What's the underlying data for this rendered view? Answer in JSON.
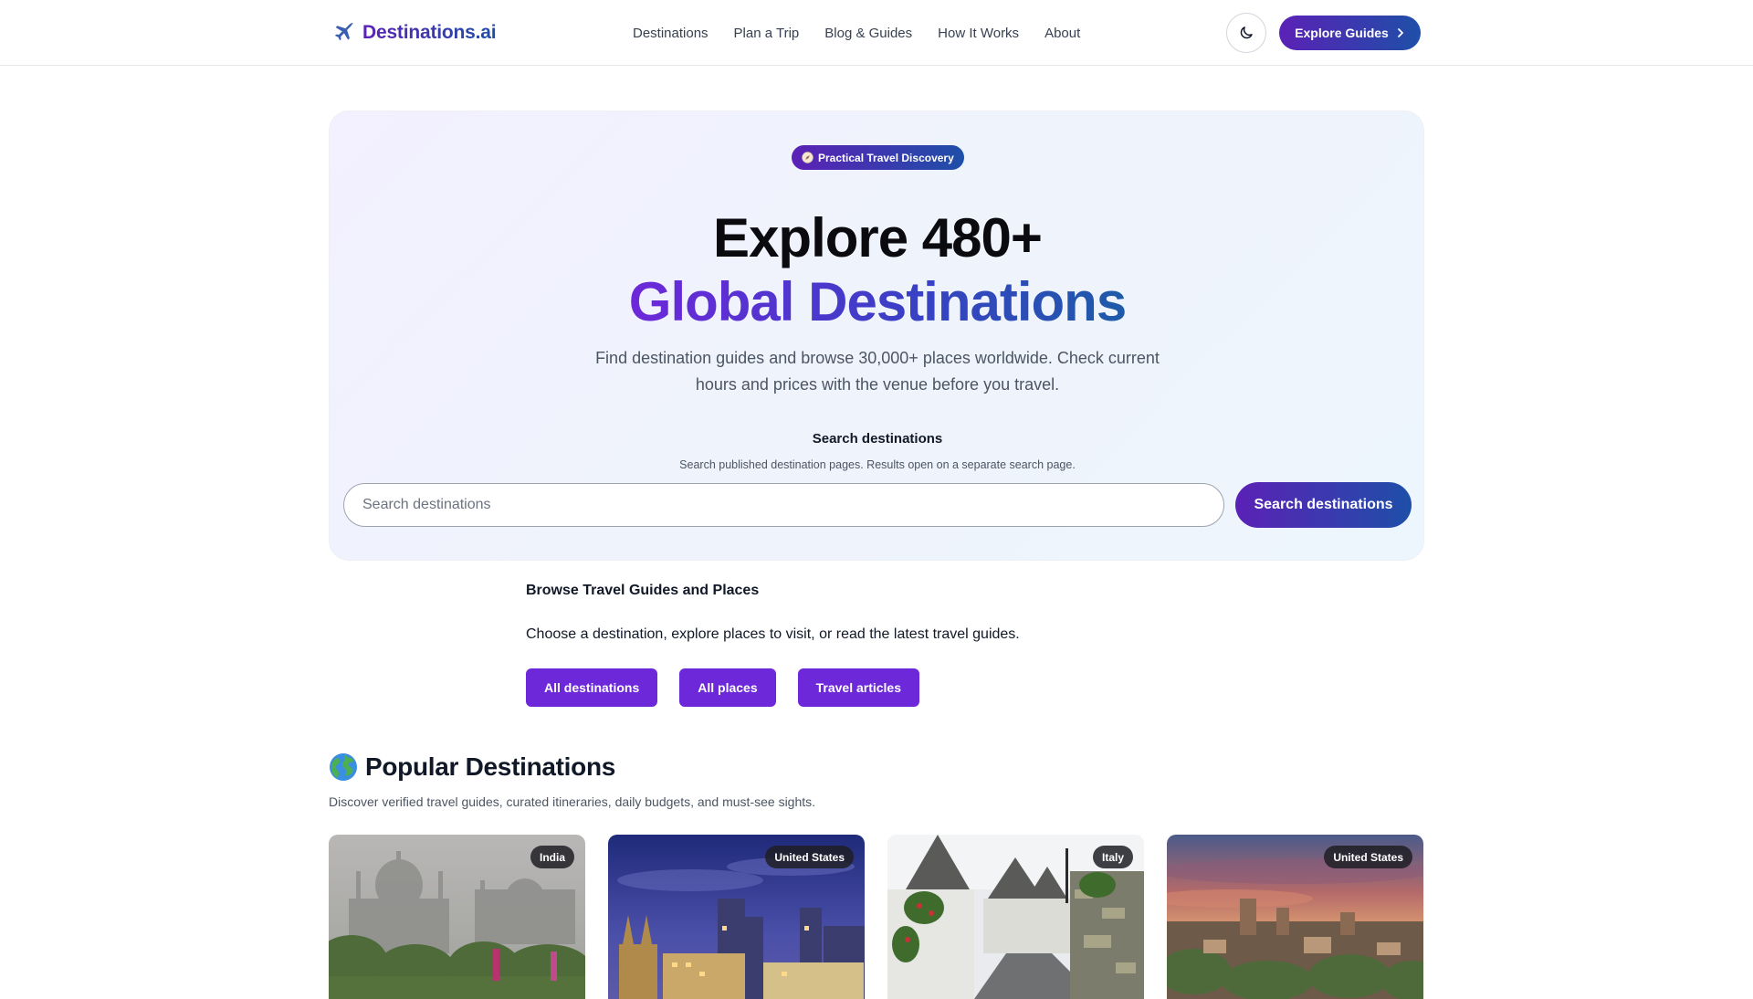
{
  "header": {
    "logo_text": "Destinations.ai",
    "logo_icon": "airplane-icon",
    "nav": [
      "Destinations",
      "Plan a Trip",
      "Blog & Guides",
      "How It Works",
      "About"
    ],
    "theme_toggle_icon": "moon-icon",
    "cta_label": "Explore Guides",
    "cta_icon": "chevron-right-icon"
  },
  "hero": {
    "badge": "Practical Travel Discovery",
    "badge_icon": "compass-icon",
    "title_line1": "Explore 480+",
    "title_line2": "Global Destinations",
    "subtitle": "Find destination guides and browse 30,000+ places worldwide. Check current hours and prices with the venue before you travel.",
    "search_heading": "Search destinations",
    "search_hint": "Search published destination pages. Results open on a separate search page.",
    "search_placeholder": "Search destinations",
    "search_value": "",
    "search_button": "Search destinations"
  },
  "browse": {
    "title": "Browse Travel Guides and Places",
    "description": "Choose a destination, explore places to visit, or read the latest travel guides.",
    "buttons": [
      "All destinations",
      "All places",
      "Travel articles"
    ]
  },
  "popular": {
    "title": "Popular Destinations",
    "title_icon": "globe-icon",
    "description": "Discover verified travel guides, curated itineraries, daily budgets, and must-see sights.",
    "cards": [
      {
        "country": "India"
      },
      {
        "country": "United States"
      },
      {
        "country": "Italy"
      },
      {
        "country": "United States"
      }
    ]
  },
  "colors": {
    "brand_purple": "#5b21b6",
    "brand_blue": "#1e4fa8",
    "button_purple": "#6d28d9",
    "hero_bg": "#f0f2fd"
  }
}
